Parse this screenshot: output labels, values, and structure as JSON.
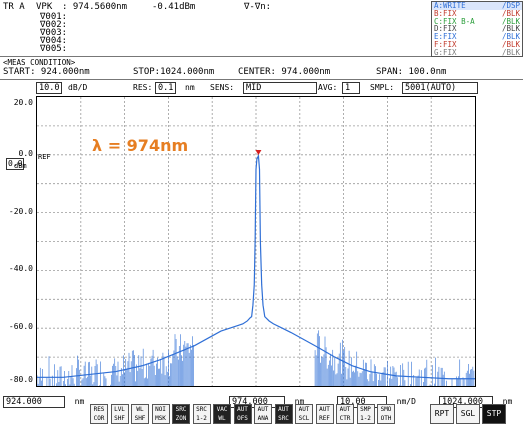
{
  "header": {
    "trace": "TR A",
    "vpk_label": "VPK",
    "vpk_value": ": 974.5600nm",
    "vpk_level": "-0.41dBm",
    "delta": "∇-∇n:",
    "markers": [
      "∇001:",
      "∇002:",
      "∇003:",
      "∇004:",
      "∇005:"
    ],
    "traces": [
      {
        "name": "A:WRITE",
        "mode": "/DSP",
        "color": "#2f6fd6",
        "highlight": true
      },
      {
        "name": "B:FIX",
        "mode": "/BLK",
        "color": "#c0392b"
      },
      {
        "name": "C:FIX  B-A",
        "mode": "/BLK",
        "color": "#2a9d3a"
      },
      {
        "name": "D:FIX",
        "mode": "/BLK",
        "color": "#444444"
      },
      {
        "name": "E:FIX",
        "mode": "/BLK",
        "color": "#2f6fd6"
      },
      {
        "name": "F:FIX",
        "mode": "/BLK",
        "color": "#c0392b"
      },
      {
        "name": "G:FIX",
        "mode": "/BLK",
        "color": "#7a7a7a"
      }
    ]
  },
  "meas": {
    "title": "<MEAS CONDITION>",
    "start": "START: 924.000nm",
    "stop": "STOP:1024.000nm",
    "center": "CENTER: 974.000nm",
    "span": "SPAN: 100.0nm"
  },
  "settings": {
    "scale": "10.0",
    "scale_unit": "dB/D",
    "res_label": "RES:",
    "res_value": "0.1",
    "res_unit": "nm",
    "sens_label": "SENS:",
    "sens_value": "MID",
    "avg_label": "AVG:",
    "avg_value": "1",
    "smpl_label": "SMPL:",
    "smpl_value": "5001(AUTO)"
  },
  "ref": {
    "value": "0.0",
    "label": "REF",
    "unit": "dBm"
  },
  "y_ticks": [
    "20.0",
    "0.0",
    "-20.0",
    "-40.0",
    "-60.0",
    "-80.0"
  ],
  "annotation": "λ = 974nm",
  "x_axis": {
    "start": "924.000",
    "start_unit": "nm",
    "center": "974.000",
    "center_unit": "nm",
    "per_div": "10.00",
    "per_div_unit": "nm/D",
    "stop": "1024.000",
    "stop_unit": "nm"
  },
  "softkeys": [
    {
      "top": "RES",
      "bot": "COR",
      "on": false
    },
    {
      "top": "LVL",
      "bot": "SHF",
      "on": false
    },
    {
      "top": "WL",
      "bot": "SHF",
      "on": false
    },
    {
      "top": "NOI",
      "bot": "MSK",
      "on": false
    },
    {
      "top": "SRC",
      "bot": "ZON",
      "on": true
    },
    {
      "top": "SRC",
      "bot": "1-2",
      "on": false
    },
    {
      "top": "VAC",
      "bot": "WL",
      "on": true
    },
    {
      "top": "AUT",
      "bot": "OFS",
      "on": true
    },
    {
      "top": "AUT",
      "bot": "ANA",
      "on": false
    },
    {
      "top": "AUT",
      "bot": "SRC",
      "on": true
    },
    {
      "top": "AUT",
      "bot": "SCL",
      "on": false
    },
    {
      "top": "AUT",
      "bot": "REF",
      "on": false
    },
    {
      "top": "AUT",
      "bot": "CTR",
      "on": false
    },
    {
      "top": "SMP",
      "bot": "1-2",
      "on": false
    },
    {
      "top": "SMO",
      "bot": "OTH",
      "on": false
    }
  ],
  "buttons": {
    "rpt": "RPT",
    "sgl": "SGL",
    "stp": "STP"
  },
  "chart_data": {
    "type": "line",
    "xlim": [
      924,
      1024
    ],
    "ylim": [
      -80,
      20
    ],
    "x_unit": "nm",
    "y_unit": "dBm",
    "series": [
      {
        "x": [
          924,
          930,
          936,
          942,
          948,
          952,
          956,
          960,
          963,
          966,
          968,
          970,
          971,
          972,
          972.6,
          973.0,
          973.3,
          973.6,
          973.8,
          974.0,
          974.2,
          974.4,
          974.56,
          974.8,
          975.0,
          975.3,
          975.6,
          976.0,
          977,
          978,
          980,
          982,
          985,
          988,
          992,
          996,
          1000,
          1006,
          1012,
          1018,
          1024
        ],
        "y": [
          -77,
          -77,
          -76,
          -75,
          -73,
          -71,
          -68.5,
          -66,
          -63.5,
          -61,
          -60,
          -59,
          -58.5,
          -57.5,
          -56.5,
          -56,
          -52,
          -45,
          -30,
          -5,
          -1.5,
          -0.8,
          -0.41,
          -5,
          -30,
          -45,
          -52,
          -56,
          -57.5,
          -58.5,
          -60,
          -61.5,
          -64,
          -66.5,
          -70,
          -73,
          -75,
          -76.5,
          -77,
          -77.5,
          -77.5
        ]
      }
    ]
  }
}
